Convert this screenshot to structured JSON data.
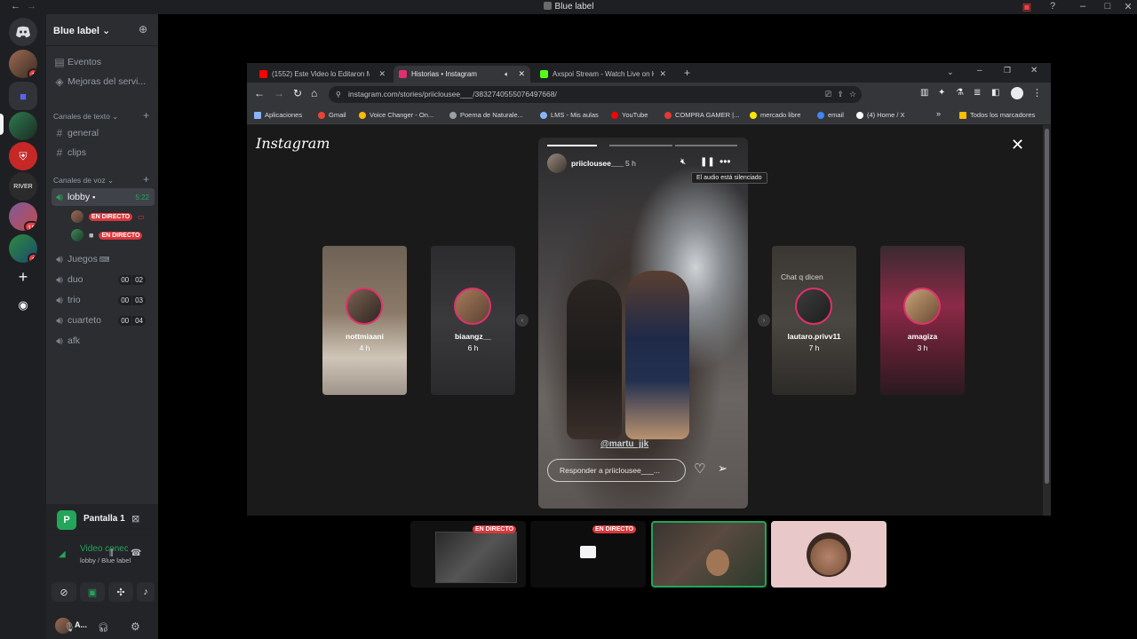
{
  "titlebar": {
    "title": "Blue label"
  },
  "rail": {
    "badges": [
      "1",
      "15",
      "1"
    ]
  },
  "sidebar": {
    "server_name": "Blue label",
    "top_items": [
      {
        "label": "Eventos"
      },
      {
        "label": "Mejoras del servi..."
      }
    ],
    "text_category": "Canales de texto",
    "text_channels": [
      "general",
      "clips"
    ],
    "voice_category": "Canales de voz",
    "voice_channels": [
      {
        "name": "lobby",
        "time": "5:22"
      },
      {
        "name": "Juegos"
      },
      {
        "name": "duo",
        "count": "00",
        "limit": "02"
      },
      {
        "name": "trio",
        "count": "00",
        "limit": "03"
      },
      {
        "name": "cuarteto",
        "count": "00",
        "limit": "04"
      },
      {
        "name": "afk"
      }
    ],
    "live_label": "EN DIRECTO",
    "screen_share": {
      "title": "Pantalla 1"
    },
    "connection": {
      "status": "Video conectac",
      "location": "lobby / Blue label"
    },
    "user": {
      "name": "A..."
    }
  },
  "browser": {
    "tabs": [
      {
        "label": "(1552) Este Video lo Editaron M",
        "color": "#ff0000"
      },
      {
        "label": "Historias • Instagram",
        "color": "#e1306c"
      },
      {
        "label": "Axspoi Stream - Watch Live on K",
        "color": "#53fc18"
      }
    ],
    "url": "instagram.com/stories/priiclousee___/3832740555076497668/",
    "bookmarks": [
      {
        "label": "Aplicaciones",
        "color": "#8ab4f8"
      },
      {
        "label": "Gmail",
        "color": "#ea4335"
      },
      {
        "label": "Voice Changer - On...",
        "color": "#fbbc04"
      },
      {
        "label": "Poema de Naturale...",
        "color": "#9aa0a6"
      },
      {
        "label": "LMS - Mis aulas",
        "color": "#8ab4f8"
      },
      {
        "label": "YouTube",
        "color": "#ff0000"
      },
      {
        "label": "COMPRA GAMER |...",
        "color": "#e53935"
      },
      {
        "label": "mercado libre",
        "color": "#ffe600"
      },
      {
        "label": "email",
        "color": "#4285f4"
      },
      {
        "label": "(4) Home / X",
        "color": "#ffffff"
      }
    ],
    "bookmarks_overflow": "»",
    "all_bookmarks": "Todos los marcadores"
  },
  "instagram": {
    "logo": "Instagram",
    "story": {
      "username": "priiclousee___",
      "time": "5 h",
      "tooltip": "El audio está silenciado",
      "mention": "@martu_jjk",
      "reply_placeholder": "Responder a priiclousee___..."
    },
    "side_stories": [
      {
        "name": "nottmiaani",
        "time": "4 h"
      },
      {
        "name": "biaangz__",
        "time": "6 h"
      },
      {
        "name": "lautaro.privv11",
        "time": "7 h"
      },
      {
        "name": "amagiza",
        "time": "3 h"
      }
    ],
    "side_caption": "Chat q dicen"
  },
  "participants": {
    "live_label": "EN DIRECTO"
  }
}
